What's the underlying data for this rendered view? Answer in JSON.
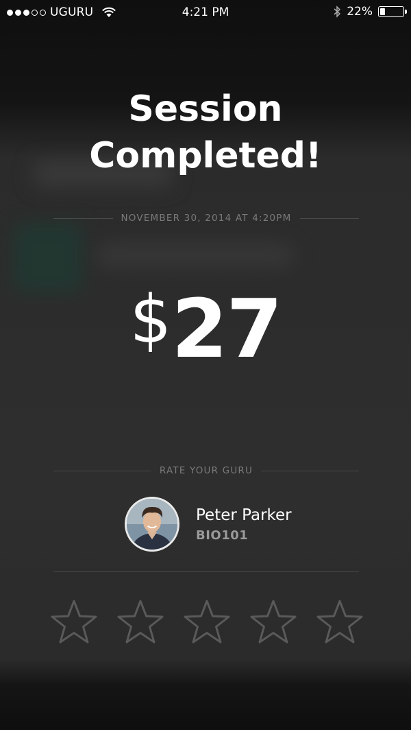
{
  "status_bar": {
    "carrier": "UGURU",
    "time": "4:21 PM",
    "battery": "22%",
    "battery_level": 0.22,
    "signal_bars_filled": 3,
    "signal_bars_total": 5
  },
  "session": {
    "title_line1": "Session",
    "title_line2": "Completed!",
    "date": "NOVEMBER 30, 2014 AT 4:20PM",
    "currency": "$",
    "amount": "27"
  },
  "rating": {
    "label": "RATE YOUR GURU",
    "guru_name": "Peter Parker",
    "course": "BIO101",
    "stars_total": 5,
    "stars_selected": 0
  },
  "colors": {
    "background": "#2e2e2e",
    "text_primary": "#ffffff",
    "text_muted": "#7a7a7a",
    "star_outline": "#5a5a5a"
  }
}
